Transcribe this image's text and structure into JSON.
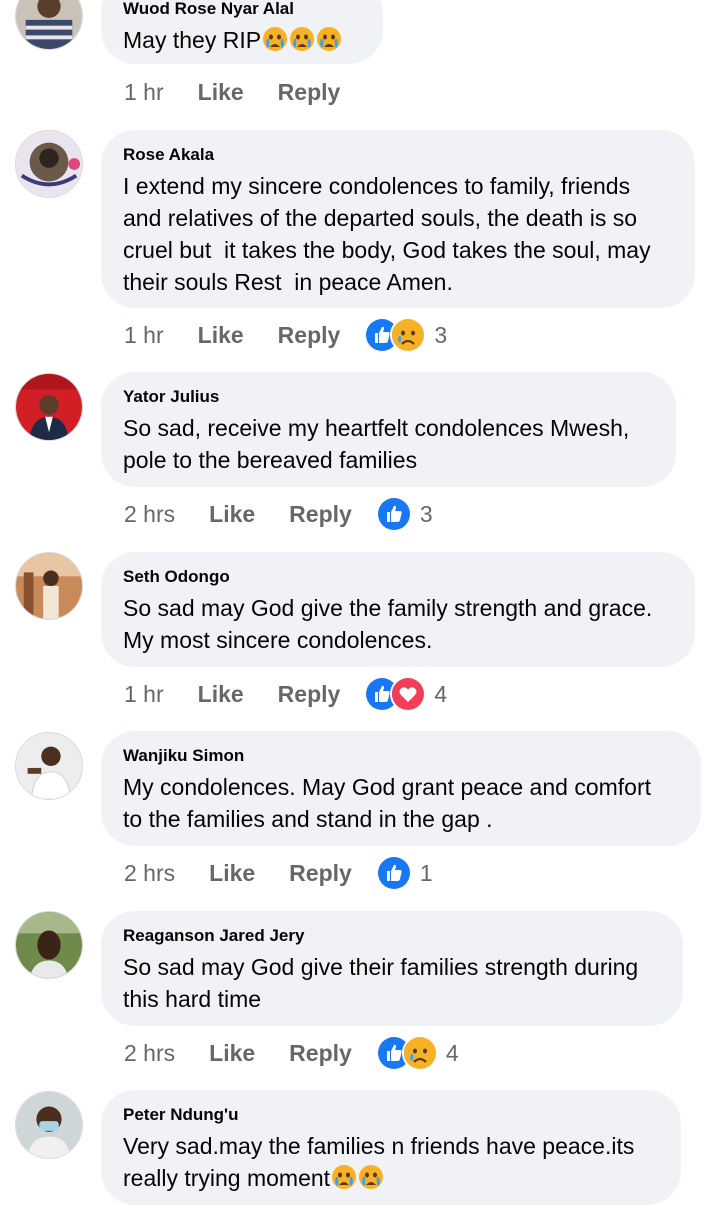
{
  "action_labels": {
    "like": "Like",
    "reply": "Reply"
  },
  "comments": [
    {
      "author": "Wuod Rose Nyar Alal",
      "text": "May they RIP",
      "time": "1 hr",
      "reaction_count": "",
      "reactions": [],
      "text_emojis": [
        "crying-face-emoji",
        "crying-face-emoji",
        "crying-face-emoji"
      ]
    },
    {
      "author": "Rose Akala",
      "text": "I extend my sincere condolences to family, friends\nand relatives of the departed souls, the death is so\ncruel but  it takes the body, God takes the soul, may\ntheir souls Rest  in peace Amen.",
      "time": "1 hr",
      "reaction_count": "3",
      "reactions": [
        "like",
        "sad"
      ]
    },
    {
      "author": "Yator Julius",
      "text": "So sad, receive my heartfelt condolences Mwesh,\npole to the bereaved families",
      "time": "2 hrs",
      "reaction_count": "3",
      "reactions": [
        "like"
      ]
    },
    {
      "author": "Seth Odongo",
      "text": "So sad may God give the family strength and grace.\nMy most sincere condolences.",
      "time": "1 hr",
      "reaction_count": "4",
      "reactions": [
        "like",
        "love"
      ]
    },
    {
      "author": "Wanjiku Simon",
      "text": "My condolences. May God grant peace and comfort\nto the families and stand in the gap .",
      "time": "2 hrs",
      "reaction_count": "1",
      "reactions": [
        "like"
      ]
    },
    {
      "author": "Reaganson Jared Jery",
      "text": "So sad may God give their families strength during\nthis hard time",
      "time": "2 hrs",
      "reaction_count": "4",
      "reactions": [
        "like",
        "sad"
      ]
    },
    {
      "author": "Peter Ndung'u",
      "text": "Very sad.may the families n friends have peace.its\nreally trying moment",
      "time": "",
      "reaction_count": "",
      "reactions": [],
      "text_emojis": [
        "crying-face-emoji",
        "crying-face-emoji"
      ]
    }
  ],
  "colors": {
    "like": "#1877f2",
    "love": "#f33e58",
    "sad": "#f7b125",
    "meta": "#65676b",
    "bubble": "#f0f2f5"
  }
}
